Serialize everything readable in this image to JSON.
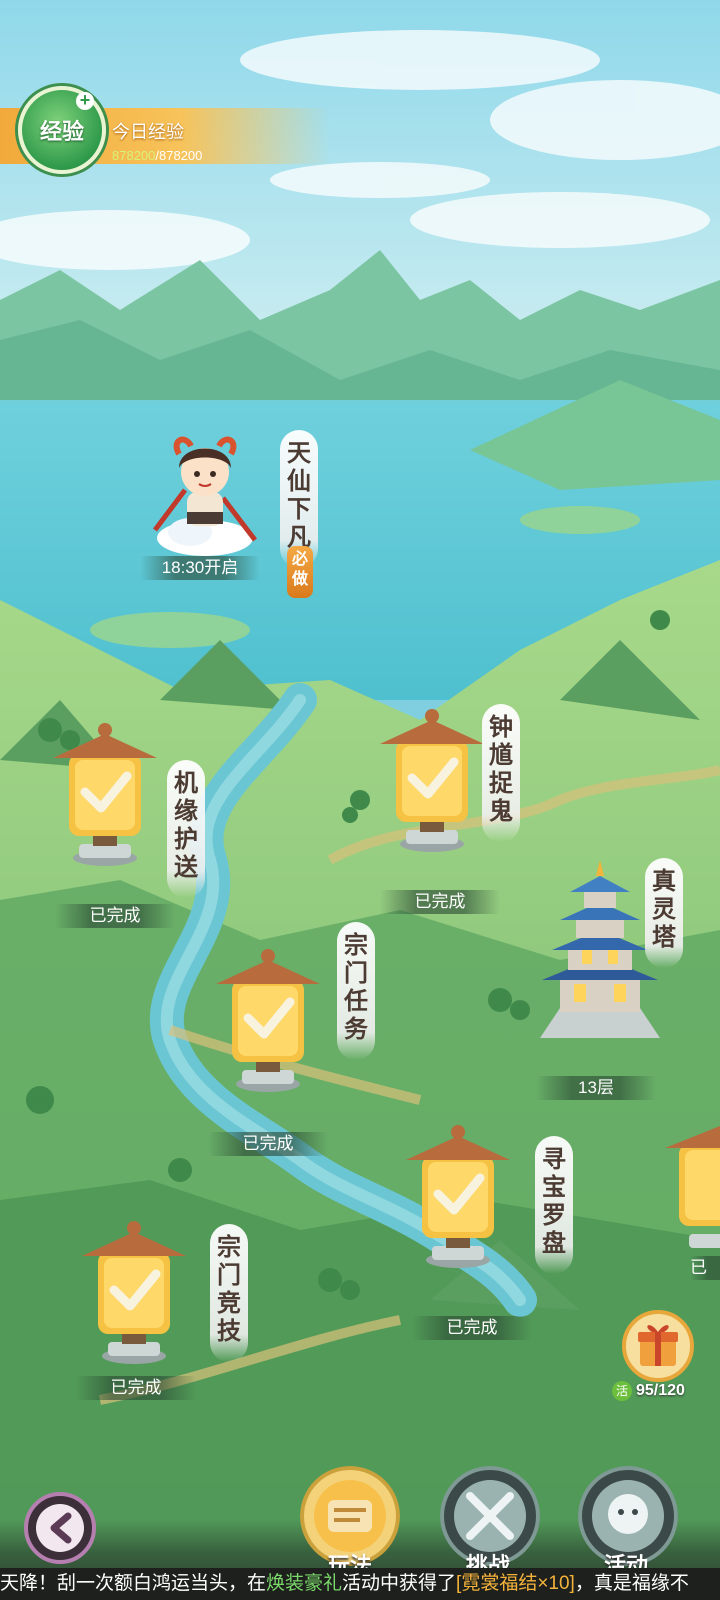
{
  "exp": {
    "badge": "经验",
    "title": "今日经验",
    "current": "878200",
    "max": "878200",
    "separator": "/"
  },
  "events": {
    "tianxian": {
      "label": "天仙下凡",
      "badge": "必做",
      "status": "18:30开启"
    },
    "jiyuan": {
      "label": "机缘护送",
      "status": "已完成"
    },
    "zhongkui": {
      "label": "钟馗捉鬼",
      "status": "已完成"
    },
    "zongmen_task": {
      "label": "宗门任务",
      "status": "已完成"
    },
    "zhenling": {
      "label": "真灵塔",
      "status": "13层"
    },
    "xunbao": {
      "label": "寻宝罗盘",
      "status": "已完成"
    },
    "zongmen_jingji": {
      "label": "宗门竞技",
      "status": "已完成"
    },
    "partial": {
      "status": "已"
    }
  },
  "activity": {
    "tag": "活",
    "count": "95/120"
  },
  "nav": {
    "play": "玩法",
    "challenge": "挑战",
    "events": "活动"
  },
  "ticker": {
    "part1": "天降！刮一次额白鸿运当头，在",
    "event": "焕装豪礼",
    "part2": "活动中获得了",
    "item": "[霓裳福结×10]",
    "part3": "，真是福缘不"
  },
  "colors": {
    "accent": "#f2a93b",
    "exp_green": "#2f9a4b",
    "label_text": "#4b3b33"
  }
}
